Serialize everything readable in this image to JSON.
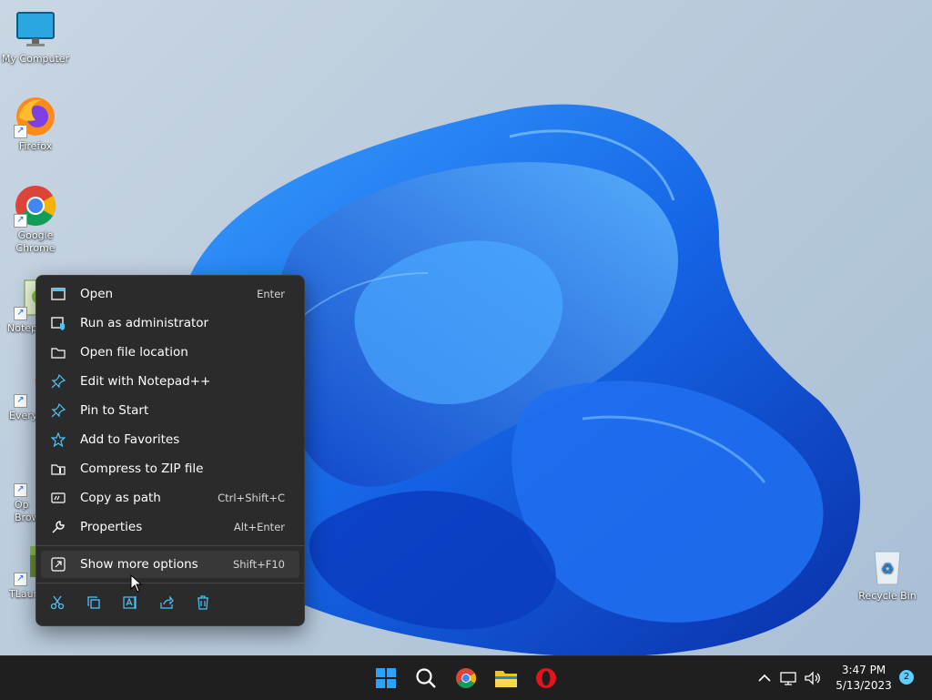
{
  "desktop": {
    "icons": [
      {
        "label": "My Computer"
      },
      {
        "label": "Firefox"
      },
      {
        "label": "Google Chrome"
      },
      {
        "label": "Notep"
      },
      {
        "label": "Every"
      },
      {
        "label": "Op Brow"
      },
      {
        "label": "TLaun"
      },
      {
        "label": "Recycle Bin"
      }
    ]
  },
  "context_menu": {
    "items": [
      {
        "label": "Open",
        "shortcut": "Enter",
        "icon": "window-icon"
      },
      {
        "label": "Run as administrator",
        "shortcut": "",
        "icon": "shield-icon"
      },
      {
        "label": "Open file location",
        "shortcut": "",
        "icon": "folder-icon"
      },
      {
        "label": "Edit with Notepad++",
        "shortcut": "",
        "icon": "pin-icon"
      },
      {
        "label": "Pin to Start",
        "shortcut": "",
        "icon": "pin-icon"
      },
      {
        "label": "Add to Favorites",
        "shortcut": "",
        "icon": "star-icon"
      },
      {
        "label": "Compress to ZIP file",
        "shortcut": "",
        "icon": "zip-folder-icon"
      },
      {
        "label": "Copy as path",
        "shortcut": "Ctrl+Shift+C",
        "icon": "path-icon"
      },
      {
        "label": "Properties",
        "shortcut": "Alt+Enter",
        "icon": "wrench-icon"
      },
      {
        "label": "Show more options",
        "shortcut": "Shift+F10",
        "icon": "expand-icon"
      }
    ],
    "toolbar": [
      "cut-icon",
      "copy-icon",
      "rename-icon",
      "share-icon",
      "delete-icon"
    ]
  },
  "taskbar": {
    "apps": [
      "start-icon",
      "search-icon",
      "chrome-icon",
      "file-explorer-icon",
      "opera-icon"
    ],
    "tray": [
      "chevron-up-icon",
      "network-icon",
      "volume-icon"
    ],
    "time": "3:47 PM",
    "date": "5/13/2023",
    "notification_count": "2"
  },
  "colors": {
    "menu_bg": "#2b2b2b",
    "menu_highlight": "#383838",
    "taskbar_bg": "#1f1f1f",
    "accent": "#60cdff"
  }
}
